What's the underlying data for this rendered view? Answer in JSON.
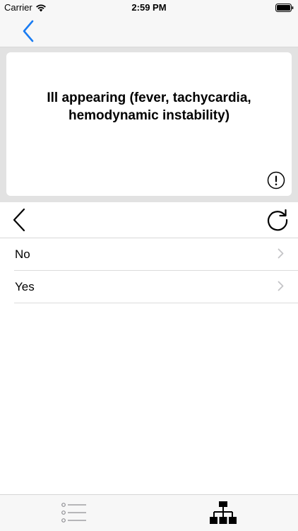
{
  "status_bar": {
    "carrier": "Carrier",
    "time": "2:59 PM"
  },
  "card": {
    "text": "Ill appearing (fever, tachycardia, hemodynamic instability)"
  },
  "options": [
    {
      "label": "No"
    },
    {
      "label": "Yes"
    }
  ],
  "icons": {
    "nav_back": "chevron-left-icon",
    "info": "exclamation-circle-icon",
    "tool_back": "chevron-left-icon",
    "restart": "refresh-icon",
    "tab_list": "list-icon",
    "tab_tree": "sitemap-icon"
  },
  "colors": {
    "accent": "#1a7cf2",
    "nav_background": "#f7f7f7",
    "card_area_background": "#e2e2e2"
  }
}
